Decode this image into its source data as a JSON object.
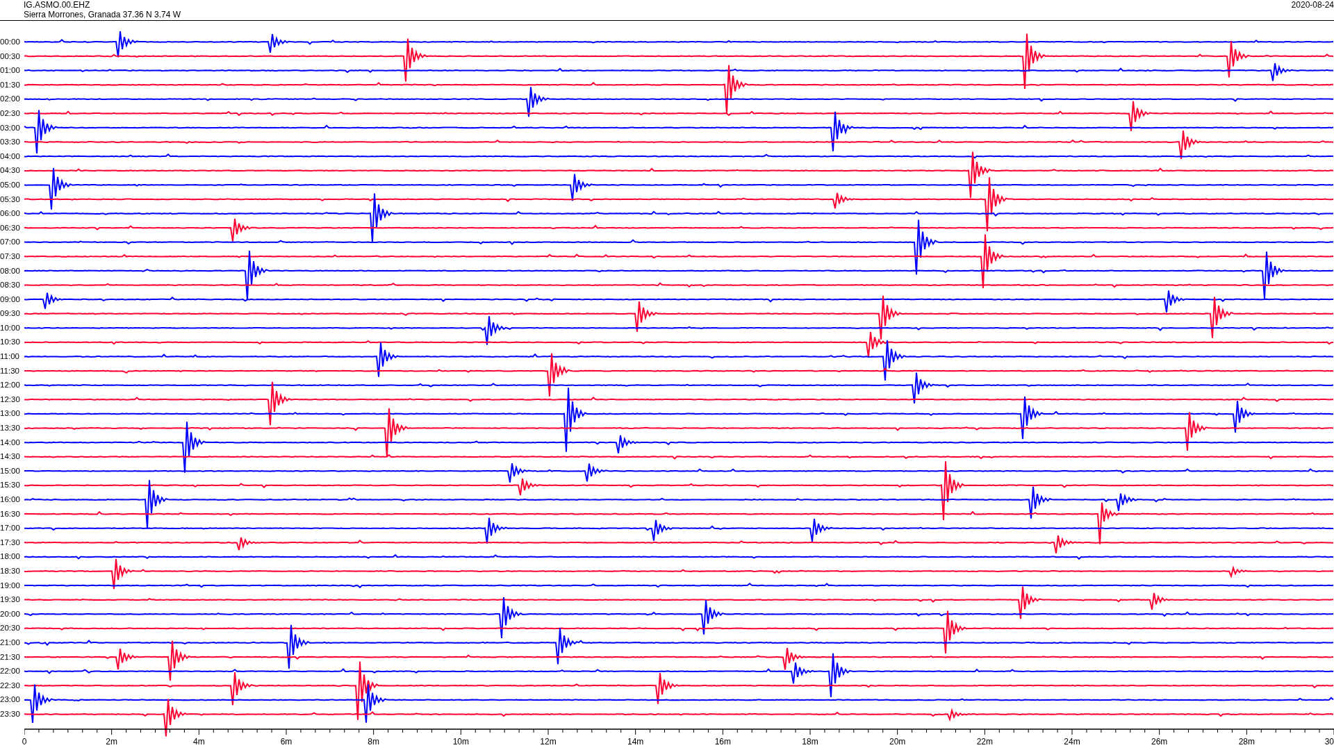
{
  "header": {
    "station": "IG.ASMO.00.EHZ",
    "location": "Sierra Morrones, Granada  37.36 N 3.74 W",
    "date": "2020-08-24"
  },
  "rows": [
    {
      "time": "00:00",
      "color": "#0000ff"
    },
    {
      "time": "00:30",
      "color": "#ff0033"
    },
    {
      "time": "01:00",
      "color": "#0000ff"
    },
    {
      "time": "01:30",
      "color": "#ff0033"
    },
    {
      "time": "02:00",
      "color": "#0000ff"
    },
    {
      "time": "02:30",
      "color": "#ff0033"
    },
    {
      "time": "03:00",
      "color": "#0000ff"
    },
    {
      "time": "03:30",
      "color": "#ff0033"
    },
    {
      "time": "04:00",
      "color": "#0000ff"
    },
    {
      "time": "04:30",
      "color": "#ff0033"
    },
    {
      "time": "05:00",
      "color": "#0000ff"
    },
    {
      "time": "05:30",
      "color": "#ff0033"
    },
    {
      "time": "06:00",
      "color": "#0000ff"
    },
    {
      "time": "06:30",
      "color": "#ff0033"
    },
    {
      "time": "07:00",
      "color": "#0000ff"
    },
    {
      "time": "07:30",
      "color": "#ff0033"
    },
    {
      "time": "08:00",
      "color": "#0000ff"
    },
    {
      "time": "08:30",
      "color": "#ff0033"
    },
    {
      "time": "09:00",
      "color": "#0000ff"
    },
    {
      "time": "09:30",
      "color": "#ff0033"
    },
    {
      "time": "10:00",
      "color": "#0000ff"
    },
    {
      "time": "10:30",
      "color": "#ff0033"
    },
    {
      "time": "11:00",
      "color": "#0000ff"
    },
    {
      "time": "11:30",
      "color": "#ff0033"
    },
    {
      "time": "12:00",
      "color": "#0000ff"
    },
    {
      "time": "12:30",
      "color": "#ff0033"
    },
    {
      "time": "13:00",
      "color": "#0000ff"
    },
    {
      "time": "13:30",
      "color": "#ff0033"
    },
    {
      "time": "14:00",
      "color": "#0000ff"
    },
    {
      "time": "14:30",
      "color": "#ff0033"
    },
    {
      "time": "15:00",
      "color": "#0000ff"
    },
    {
      "time": "15:30",
      "color": "#ff0033"
    },
    {
      "time": "16:00",
      "color": "#0000ff"
    },
    {
      "time": "16:30",
      "color": "#ff0033"
    },
    {
      "time": "17:00",
      "color": "#0000ff"
    },
    {
      "time": "17:30",
      "color": "#ff0033"
    },
    {
      "time": "18:00",
      "color": "#0000ff"
    },
    {
      "time": "18:30",
      "color": "#ff0033"
    },
    {
      "time": "19:00",
      "color": "#0000ff"
    },
    {
      "time": "19:30",
      "color": "#ff0033"
    },
    {
      "time": "20:00",
      "color": "#0000ff"
    },
    {
      "time": "20:30",
      "color": "#ff0033"
    },
    {
      "time": "21:00",
      "color": "#0000ff"
    },
    {
      "time": "21:30",
      "color": "#ff0033"
    },
    {
      "time": "22:00",
      "color": "#0000ff"
    },
    {
      "time": "22:30",
      "color": "#ff0033"
    },
    {
      "time": "23:00",
      "color": "#0000ff"
    },
    {
      "time": "23:30",
      "color": "#ff0033"
    }
  ],
  "x_axis": {
    "labels": [
      "0",
      "2m",
      "4m",
      "6m",
      "8m",
      "10m",
      "12m",
      "14m",
      "16m",
      "18m",
      "20m",
      "22m",
      "24m",
      "26m",
      "28m",
      "30"
    ]
  }
}
